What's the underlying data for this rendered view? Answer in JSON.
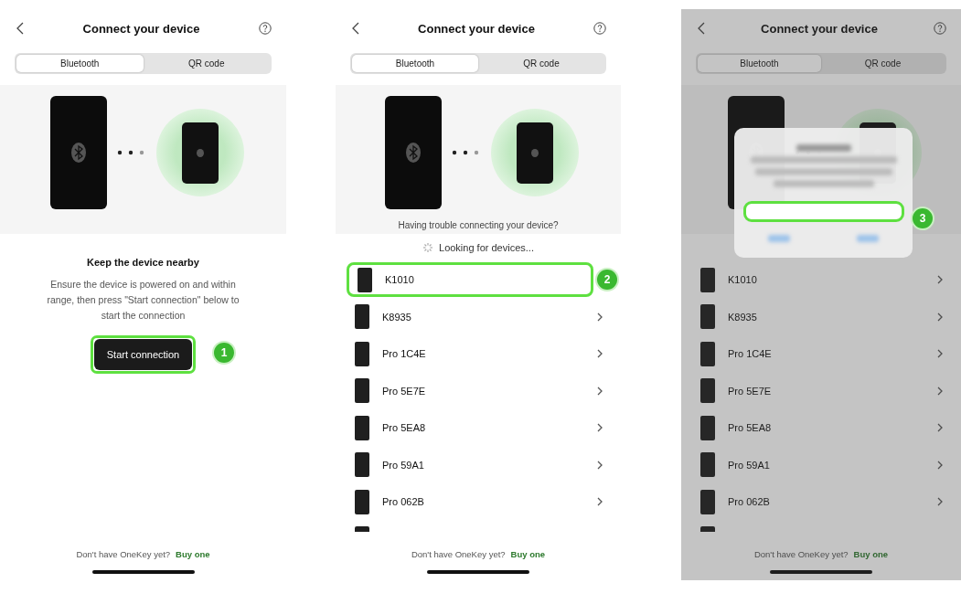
{
  "screens": [
    {
      "kind": "intro",
      "title": "Connect your device",
      "tabs": [
        {
          "label": "Bluetooth",
          "selected": true
        },
        {
          "label": "QR code",
          "selected": false
        }
      ],
      "heading": "Keep the device nearby",
      "body": "Ensure the device is powered on and within range, then press \"Start connection\" below to start the connection",
      "button": {
        "label": "Start connection",
        "step": "1"
      },
      "footer": {
        "text": "Don't have OneKey yet?",
        "link": "Buy one"
      }
    },
    {
      "kind": "list",
      "title": "Connect your device",
      "tabs": [
        {
          "label": "Bluetooth",
          "selected": true
        },
        {
          "label": "QR code",
          "selected": false
        }
      ],
      "trouble": "Having trouble connecting your device?",
      "searching": "Looking for devices...",
      "devices": [
        {
          "name": "K1010",
          "highlighted": true,
          "step": "2"
        },
        {
          "name": "K8935",
          "highlighted": false
        },
        {
          "name": "Pro 1C4E",
          "highlighted": false
        },
        {
          "name": "Pro 5E7E",
          "highlighted": false
        },
        {
          "name": "Pro 5EA8",
          "highlighted": false
        },
        {
          "name": "Pro 59A1",
          "highlighted": false
        },
        {
          "name": "Pro 062B",
          "highlighted": false
        }
      ],
      "footer": {
        "text": "Don't have OneKey yet?",
        "link": "Buy one"
      }
    },
    {
      "kind": "list",
      "dimmed": true,
      "title": "Connect your device",
      "tabs": [
        {
          "label": "Bluetooth",
          "selected": true
        },
        {
          "label": "QR code",
          "selected": false
        }
      ],
      "dialog": {
        "step": "3"
      },
      "devices": [
        {
          "name": "K1010",
          "highlighted": false
        },
        {
          "name": "K8935",
          "highlighted": false
        },
        {
          "name": "Pro 1C4E",
          "highlighted": false
        },
        {
          "name": "Pro 5E7E",
          "highlighted": false
        },
        {
          "name": "Pro 5EA8",
          "highlighted": false
        },
        {
          "name": "Pro 59A1",
          "highlighted": false
        },
        {
          "name": "Pro 062B",
          "highlighted": false
        }
      ],
      "footer": {
        "text": "Don't have OneKey yet?",
        "link": "Buy one"
      }
    }
  ]
}
